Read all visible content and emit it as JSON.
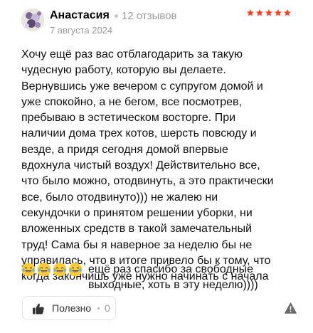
{
  "author": {
    "name": "Анастасия",
    "review_count": "12 отзывов",
    "date": "7 августа 2024",
    "avatar_icon": "avatar-photo-icon"
  },
  "rating": {
    "value": 5,
    "max": 5,
    "star_color": "#fc3f1d",
    "star_icon": "star-icon"
  },
  "review": {
    "text": "Хочу ещё раз вас отблагодарить за такую\nчудесную работу, которую вы делаете.\nВернувшись уже вечером с супругом домой и\nуже спокойно, а не бегом, все посмотрев,\nпребываю в эстетическом восторге. При\nналичии дома трех котов, шерсть повсюду и\nвезде, а придя сегодня домой впервые\nвдохнула чистый воздух! Действительно все,\nчто было можно, отодвинуть, а это практически\nвсе, было отодвинуто))) не жалею ни\nсекундочки о принятом решении уборки, ни\nвложенных средств в такой замечательный\nтруд! Сама бы я наверное за неделю бы не\nуправилась, что в итоге привело бы к тому, что\nкогда закончишь уже нужно начинать с начала",
    "emojis": [
      "😂",
      "😂",
      "😂",
      "😂"
    ],
    "emoji_icon": "laughing-with-tears-emoji-icon",
    "text_after_emojis": "ещё раз спасибо за свободные\nвыходные, хоть в эту неделю))))"
  },
  "actions": {
    "useful_label": "Полезно",
    "useful_count": "0",
    "useful_icon": "thumbs-up-icon",
    "report_icon": "warning-icon"
  }
}
